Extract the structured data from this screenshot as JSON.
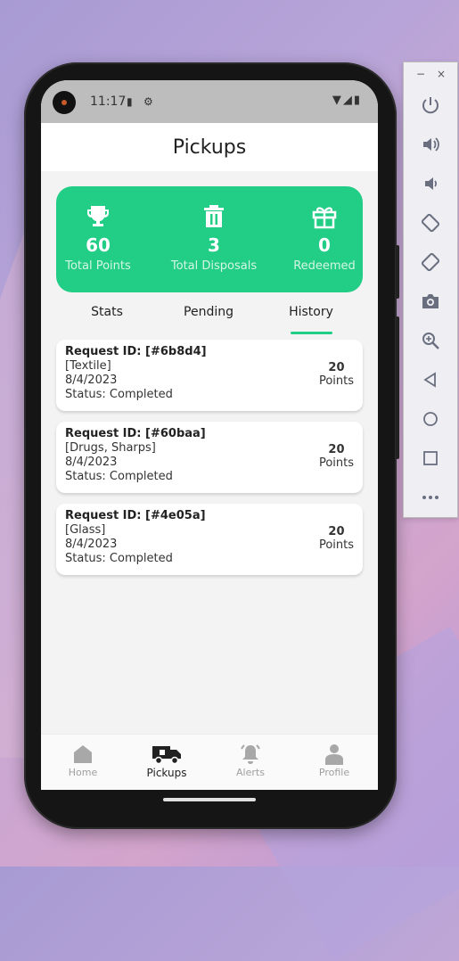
{
  "status_bar": {
    "time": "11:17"
  },
  "app_bar": {
    "title": "Pickups"
  },
  "stats": [
    {
      "value": "60",
      "label": "Total Points",
      "icon": "trophy-icon"
    },
    {
      "value": "3",
      "label": "Total Disposals",
      "icon": "trash-icon"
    },
    {
      "value": "0",
      "label": "Redeemed",
      "icon": "gift-icon"
    }
  ],
  "tabs": [
    {
      "label": "Stats"
    },
    {
      "label": "Pending"
    },
    {
      "label": "History",
      "selected": true
    }
  ],
  "requests": [
    {
      "id": "Request ID: [#6b8d4]",
      "category": "[Textile]",
      "date": "8/4/2023",
      "status": "Status: Completed",
      "points_value": "20",
      "points_label": "Points"
    },
    {
      "id": "Request ID: [#60baa]",
      "category": "[Drugs, Sharps]",
      "date": "8/4/2023",
      "status": "Status: Completed",
      "points_value": "20",
      "points_label": "Points"
    },
    {
      "id": "Request ID: [#4e05a]",
      "category": "[Glass]",
      "date": "8/4/2023",
      "status": "Status: Completed",
      "points_value": "20",
      "points_label": "Points"
    }
  ],
  "nav": [
    {
      "label": "Home",
      "icon": "home-icon"
    },
    {
      "label": "Pickups",
      "icon": "truck-icon",
      "active": true
    },
    {
      "label": "Alerts",
      "icon": "bell-icon"
    },
    {
      "label": "Profile",
      "icon": "profile-icon"
    }
  ],
  "emulator_toolbar": {
    "minimize": "−",
    "close": "×",
    "buttons": [
      "power-icon",
      "volume-up-icon",
      "volume-down-icon",
      "rotate-left-icon",
      "rotate-right-icon",
      "camera-icon",
      "zoom-icon",
      "back-icon",
      "home-circle-icon",
      "overview-icon",
      "more-icon"
    ]
  },
  "colors": {
    "accent": "#22cd86",
    "background": "#f3f3f3"
  }
}
